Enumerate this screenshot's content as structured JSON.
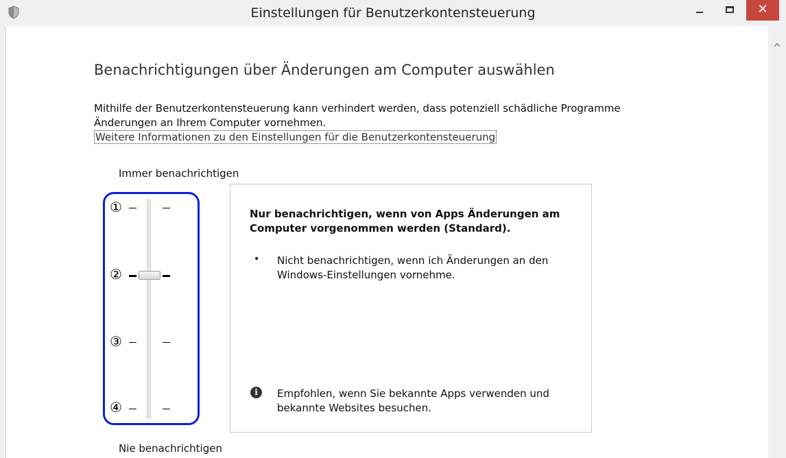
{
  "window": {
    "title": "Einstellungen für Benutzerkontensteuerung",
    "app_icon": "uac-shield-icon",
    "controls": {
      "minimize": "–",
      "maximize": "□",
      "close": "✕"
    }
  },
  "main": {
    "heading": "Benachrichtigungen über Änderungen am Computer auswählen",
    "description_line1": "Mithilfe der Benutzerkontensteuerung kann verhindert werden, dass potenziell schädliche Programme",
    "description_line2": "Änderungen an Ihrem Computer vornehmen.",
    "more_info_link": "Weitere Informationen zu den Einstellungen für die Benutzerkontensteuerung"
  },
  "slider": {
    "top_label": "Immer benachrichtigen",
    "bottom_label": "Nie benachrichtigen",
    "level_markers": [
      "①",
      "②",
      "③",
      "④"
    ],
    "selected_level": 2,
    "level_count": 4
  },
  "detail": {
    "title_line1": "Nur benachrichtigen, wenn von Apps Änderungen am",
    "title_line2": "Computer vorgenommen werden (Standard).",
    "bullet": "•",
    "bullet_line1": "Nicht benachrichtigen, wenn ich Änderungen an den",
    "bullet_line2": "Windows-Einstellungen vornehme.",
    "info_icon": "info-icon",
    "info_glyph": "i",
    "info_line1": "Empfohlen, wenn Sie bekannte Apps verwenden und",
    "info_line2": "bekannte Websites besuchen."
  },
  "colors": {
    "highlight": "#0a1fdc",
    "close_button": "#c7463d"
  }
}
